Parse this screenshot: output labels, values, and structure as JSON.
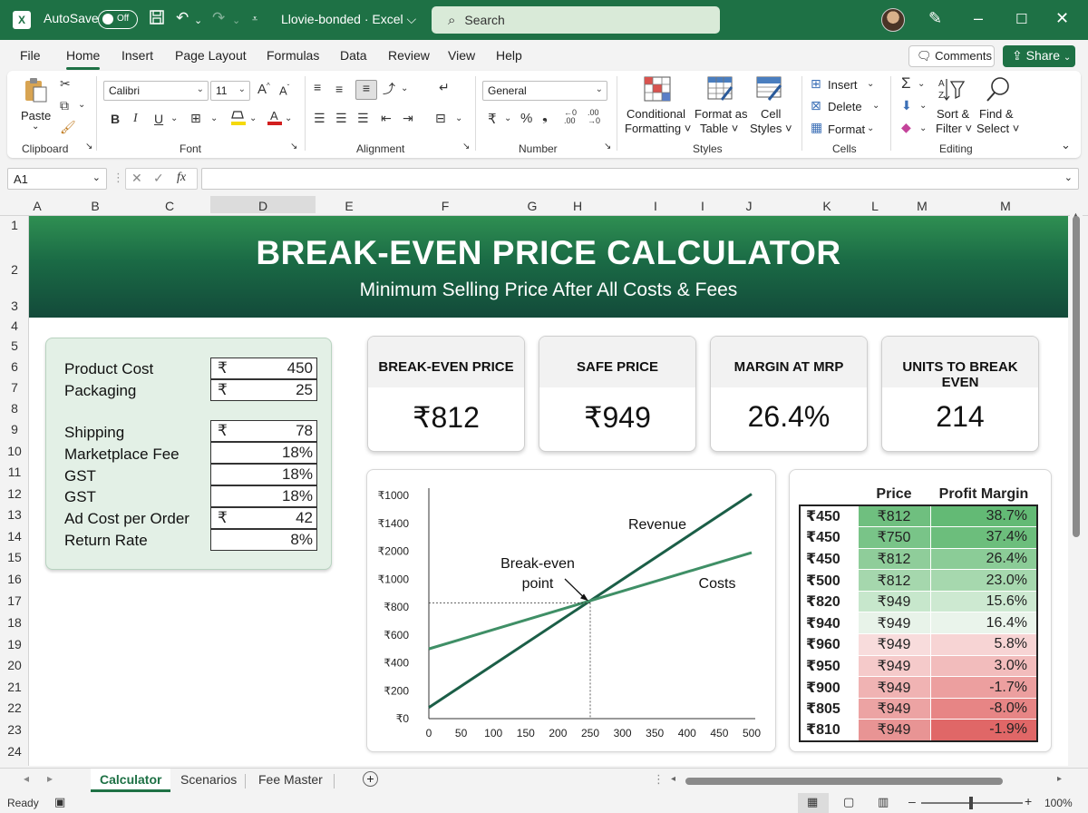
{
  "titlebar": {
    "autosave_label": "AutoSave",
    "autosave_state": "Off",
    "doc_title": "Llovie-bonded · Excel ⌵",
    "search_placeholder": "Search"
  },
  "menu": [
    "File",
    "Home",
    "Insert",
    "Page Layout",
    "Formulas",
    "Data",
    "Review",
    "View",
    "Help"
  ],
  "menu_active": "Home",
  "comments_label": "Comments",
  "share_label": "Share",
  "ribbon": {
    "clipboard": {
      "paste": "Paste",
      "label": "Clipboard"
    },
    "font": {
      "name": "Calibri",
      "size": "11",
      "label": "Font",
      "bold": "B",
      "italic": "I",
      "underline": "U"
    },
    "alignment": {
      "label": "Alignment"
    },
    "number": {
      "format": "General",
      "label": "Number"
    },
    "styles": {
      "cond_formatting_1": "Conditional",
      "cond_formatting_2": "Formatting ˅",
      "format_table_1": "Format as",
      "format_table_2": "Table ˅",
      "cell_styles_1": "Cell",
      "cell_styles_2": "Styles ˅",
      "label": "Styles"
    },
    "cells": {
      "insert": "Insert",
      "delete": "Delete",
      "format": "Format",
      "label": "Cells"
    },
    "editing": {
      "sort_1": "Sort &",
      "sort_2": "Filter ˅",
      "find_1": "Find &",
      "find_2": "Select ˅",
      "label": "Editing"
    }
  },
  "formula_bar": {
    "name_box": "A1",
    "fx": "fx",
    "formula": ""
  },
  "columns": [
    "A",
    "B",
    "C",
    "D",
    "E",
    "F",
    "G",
    "H",
    "I",
    "I",
    "J",
    "K",
    "L",
    "M",
    "M"
  ],
  "rows": [
    "1",
    "2",
    "3",
    "4",
    "5",
    "6",
    "7",
    "8",
    "9",
    "10",
    "11",
    "12",
    "13",
    "14",
    "15",
    "16",
    "17",
    "18",
    "19",
    "20",
    "21",
    "22",
    "23",
    "24"
  ],
  "banner": {
    "title": "BREAK-EVEN PRICE CALCULATOR",
    "subtitle": "Minimum Selling Price After All Costs & Fees"
  },
  "inputs": [
    {
      "label": "Product Cost",
      "currency": "₹",
      "value": "450"
    },
    {
      "label": "Packaging",
      "currency": "₹",
      "value": "25"
    },
    {
      "label": "Shipping",
      "currency": "₹",
      "value": "78"
    },
    {
      "label": "Marketplace Fee",
      "currency": "",
      "value": "18%"
    },
    {
      "label": "GST",
      "currency": "",
      "value": "18%"
    },
    {
      "label": "GST",
      "currency": "",
      "value": "18%"
    },
    {
      "label": "Ad Cost per Order",
      "currency": "₹",
      "value": "42"
    },
    {
      "label": "Return Rate",
      "currency": "",
      "value": "8%"
    }
  ],
  "kpis": [
    {
      "title": "BREAK-EVEN PRICE",
      "value": "₹812"
    },
    {
      "title": "SAFE PRICE",
      "value": "₹949"
    },
    {
      "title": "MARGIN AT MRP",
      "value": "26.4%"
    },
    {
      "title": "UNITS TO BREAK EVEN",
      "value": "214"
    }
  ],
  "chart_data": {
    "type": "line",
    "x": [
      0,
      500
    ],
    "y_tick_labels": [
      "₹0",
      "₹200",
      "₹400",
      "₹600",
      "₹800",
      "₹1000",
      "₹2000",
      "₹1400",
      "₹1000"
    ],
    "x_tick_labels": [
      "0",
      "50",
      "100",
      "150",
      "200",
      "250",
      "300",
      "350",
      "400",
      "450",
      "500"
    ],
    "series": [
      {
        "name": "Revenue",
        "start_tick": 0.4,
        "end_tick": 8.05,
        "color": "#1b5e47"
      },
      {
        "name": "Costs",
        "start_tick": 2.5,
        "end_tick": 5.95,
        "color": "#3f8f66"
      }
    ],
    "break_even": {
      "x": 250,
      "y_tick": 4.15,
      "label_1": "Break-even",
      "label_2": "point"
    },
    "grid": false,
    "legend": "none"
  },
  "price_table": {
    "headers": [
      "",
      "Price",
      "Profit Margin"
    ],
    "rows": [
      {
        "cost": "₹450",
        "price": "₹812",
        "margin": "38.7%",
        "pcolor": "#6fbf7f",
        "mcolor": "#63ba75"
      },
      {
        "cost": "₹450",
        "price": "₹750",
        "margin": "37.4%",
        "pcolor": "#79c488",
        "mcolor": "#6cbe7c"
      },
      {
        "cost": "₹450",
        "price": "₹812",
        "margin": "26.4%",
        "pcolor": "#8fcd9a",
        "mcolor": "#8bcc97"
      },
      {
        "cost": "₹500",
        "price": "₹812",
        "margin": "23.0%",
        "pcolor": "#a5d7ad",
        "mcolor": "#a6d8ae"
      },
      {
        "cost": "₹820",
        "price": "₹949",
        "margin": "15.6%",
        "pcolor": "#c7e7cc",
        "mcolor": "#cde9d1"
      },
      {
        "cost": "₹940",
        "price": "₹949",
        "margin": "16.4%",
        "pcolor": "#e8f3e9",
        "mcolor": "#eaf4eb"
      },
      {
        "cost": "₹960",
        "price": "₹949",
        "margin": "5.8%",
        "pcolor": "#f8dcdc",
        "mcolor": "#f7d4d4"
      },
      {
        "cost": "₹950",
        "price": "₹949",
        "margin": "3.0%",
        "pcolor": "#f5caca",
        "mcolor": "#f2bcbc"
      },
      {
        "cost": "₹900",
        "price": "₹949",
        "margin": "-1.7%",
        "pcolor": "#f0b3b3",
        "mcolor": "#ec9f9f"
      },
      {
        "cost": "₹805",
        "price": "₹949",
        "margin": "-8.0%",
        "pcolor": "#eca3a3",
        "mcolor": "#e78585"
      },
      {
        "cost": "₹810",
        "price": "₹949",
        "margin": "-1.9%",
        "pcolor": "#e89494",
        "mcolor": "#e06767"
      }
    ]
  },
  "sheet_tabs": [
    "Calculator",
    "Scenarios",
    "Fee Master"
  ],
  "active_tab": "Calculator",
  "status": {
    "ready": "Ready",
    "zoom": "100%"
  },
  "colors": {
    "accent": "#1e7145",
    "banner_dark": "#134a3a",
    "panel_bg": "#e3f0e6"
  }
}
